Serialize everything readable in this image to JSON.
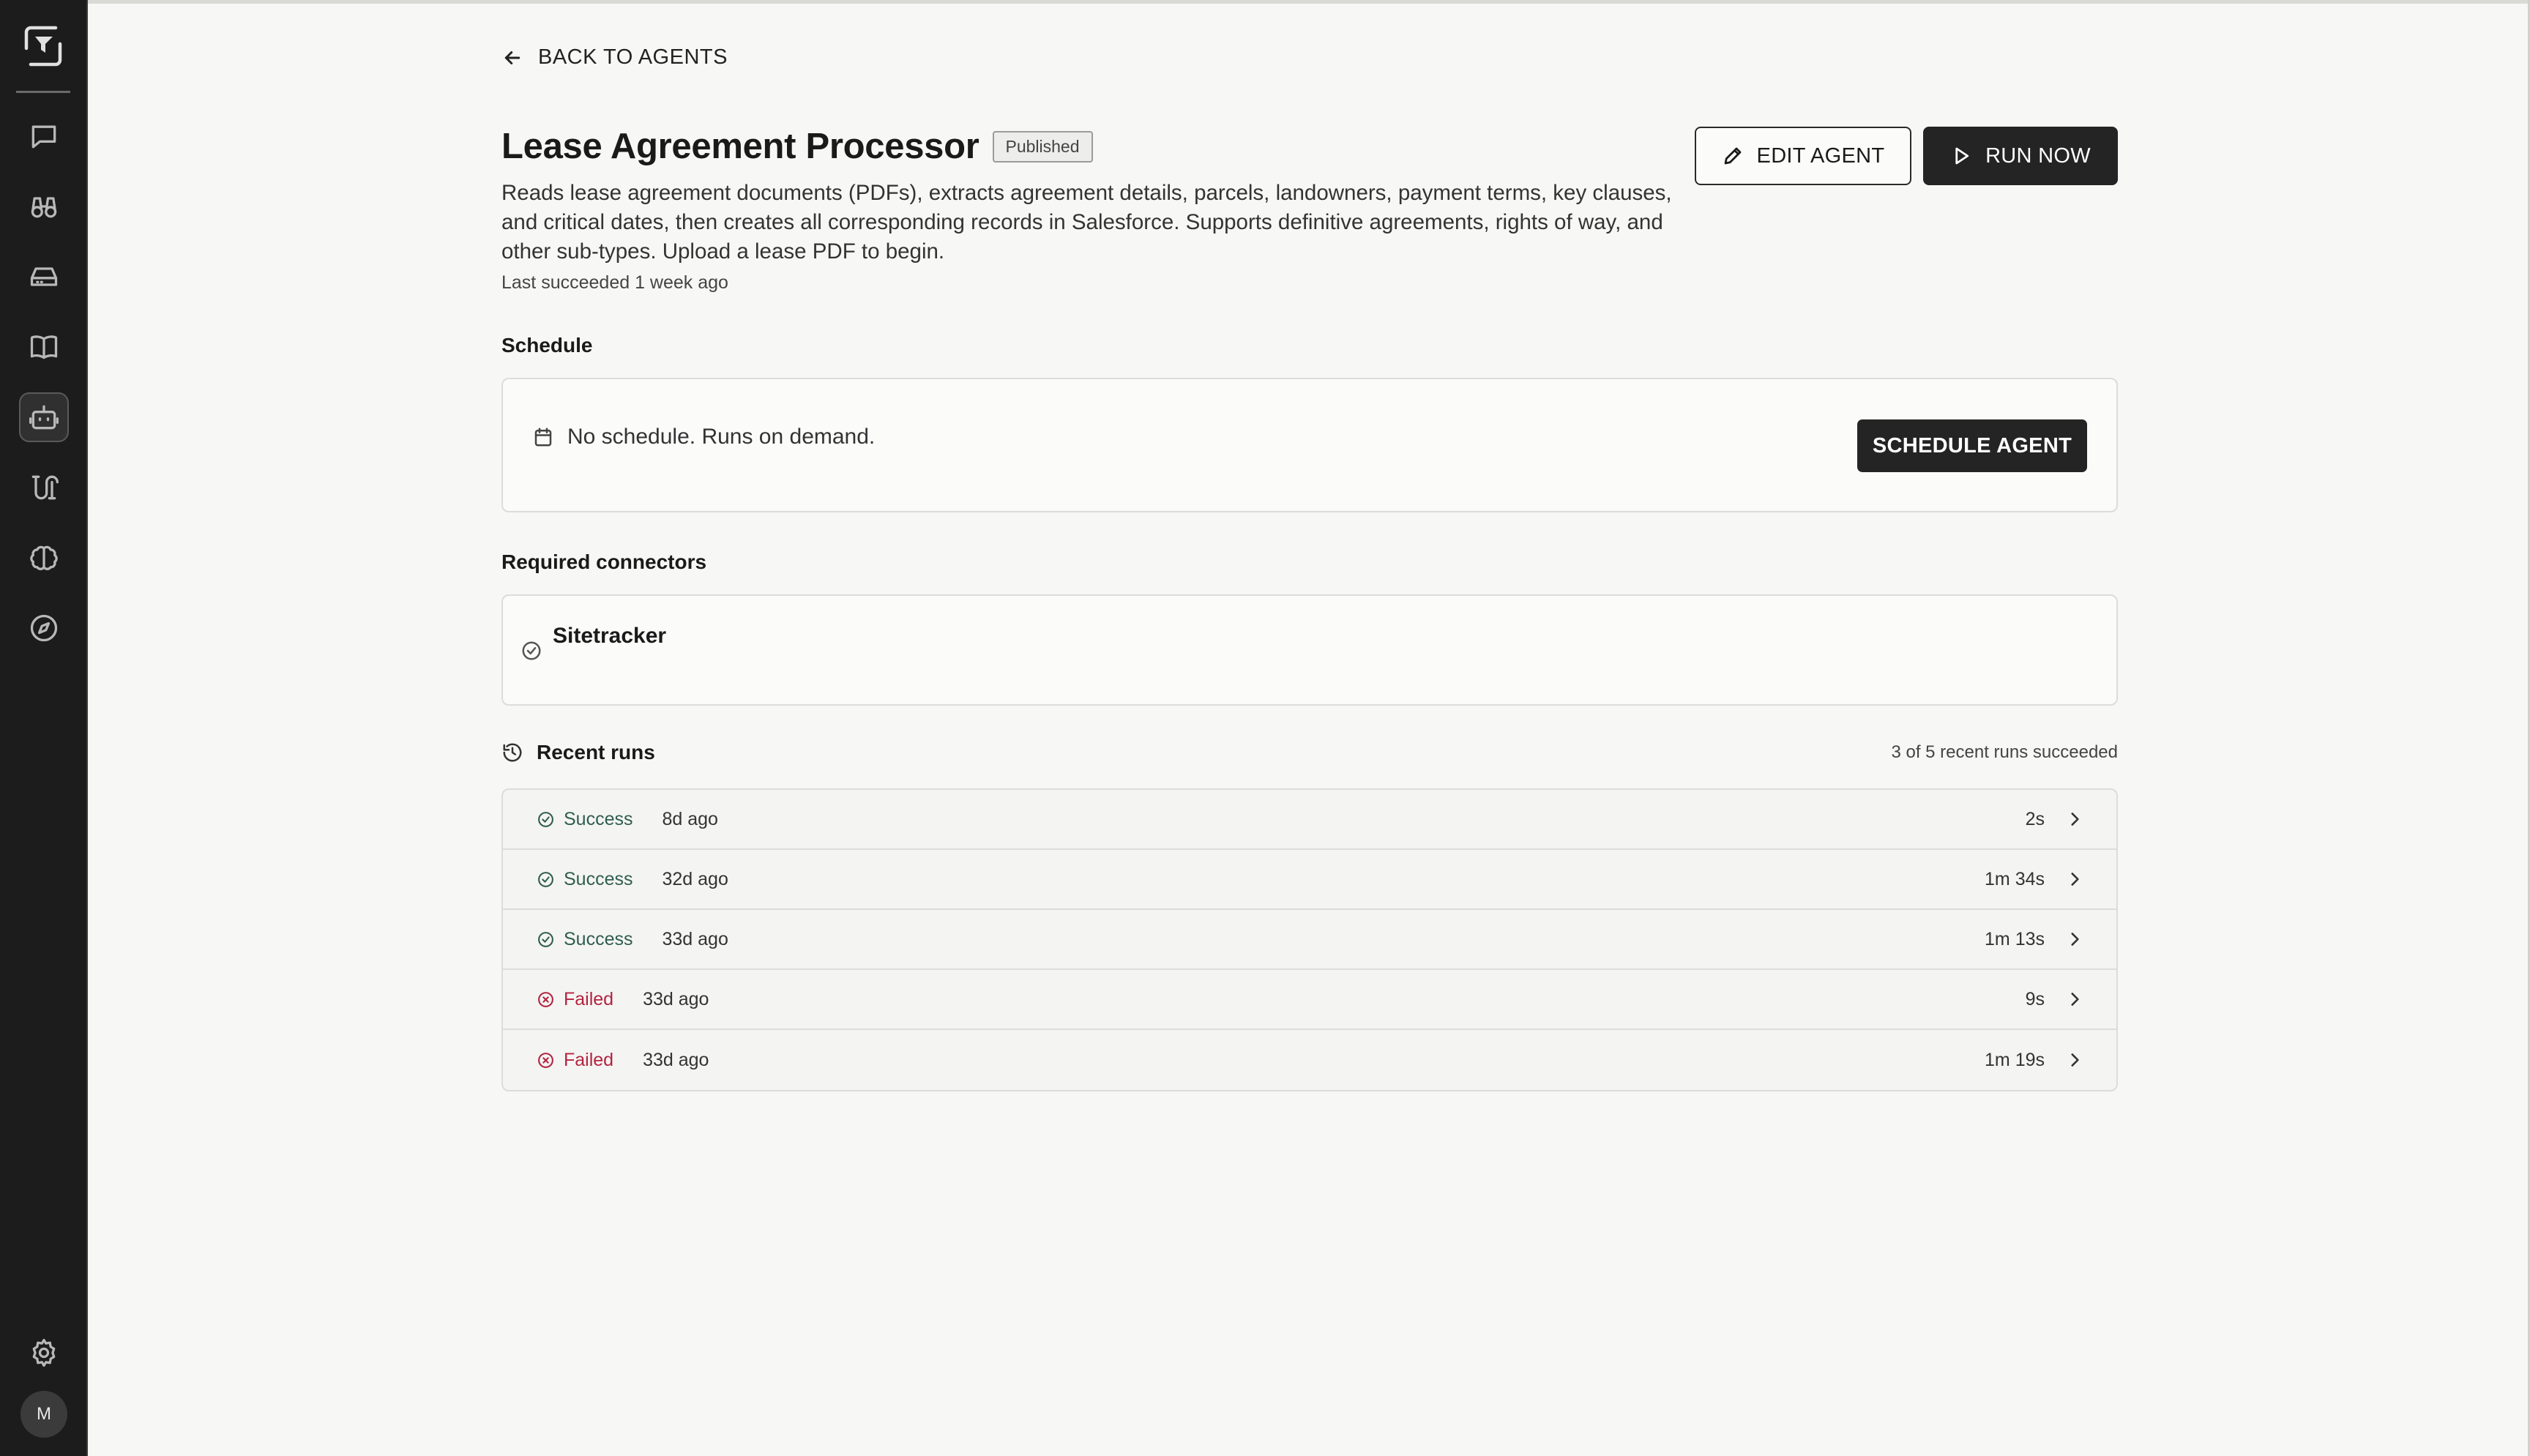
{
  "sidebar": {
    "items": [
      {
        "icon": "chat-icon"
      },
      {
        "icon": "binoculars-icon"
      },
      {
        "icon": "inbox-icon"
      },
      {
        "icon": "book-icon"
      },
      {
        "icon": "bot-icon",
        "active": true
      },
      {
        "icon": "workflow-icon"
      },
      {
        "icon": "brain-icon"
      },
      {
        "icon": "compass-icon"
      }
    ],
    "settings_icon": "gear-icon",
    "avatar_initial": "M"
  },
  "header": {
    "back_label": "BACK TO AGENTS",
    "title": "Lease Agreement Processor",
    "badge": "Published",
    "description": "Reads lease agreement documents (PDFs), extracts agreement details, parcels, landowners, payment terms, key clauses, and critical dates, then creates all corresponding records in Salesforce. Supports definitive agreements, rights of way, and other sub-types. Upload a lease PDF to begin.",
    "last_succeeded": "Last succeeded 1 week ago",
    "edit_label": "EDIT AGENT",
    "run_label": "RUN NOW"
  },
  "schedule": {
    "heading": "Schedule",
    "text": "No schedule. Runs on demand.",
    "button": "SCHEDULE AGENT"
  },
  "connectors": {
    "heading": "Required connectors",
    "items": [
      "Sitetracker"
    ]
  },
  "recent_runs": {
    "heading": "Recent runs",
    "summary": "3 of 5 recent runs succeeded",
    "rows": [
      {
        "status": "Success",
        "ago": "8d ago",
        "duration": "2s"
      },
      {
        "status": "Success",
        "ago": "32d ago",
        "duration": "1m 34s"
      },
      {
        "status": "Success",
        "ago": "33d ago",
        "duration": "1m 13s"
      },
      {
        "status": "Failed",
        "ago": "33d ago",
        "duration": "9s"
      },
      {
        "status": "Failed",
        "ago": "33d ago",
        "duration": "1m 19s"
      }
    ]
  },
  "colors": {
    "sidebar_bg": "#1c1c1c",
    "page_bg": "#f7f7f5",
    "primary_button": "#242424",
    "success": "#2f5d50",
    "failed": "#b32340"
  }
}
